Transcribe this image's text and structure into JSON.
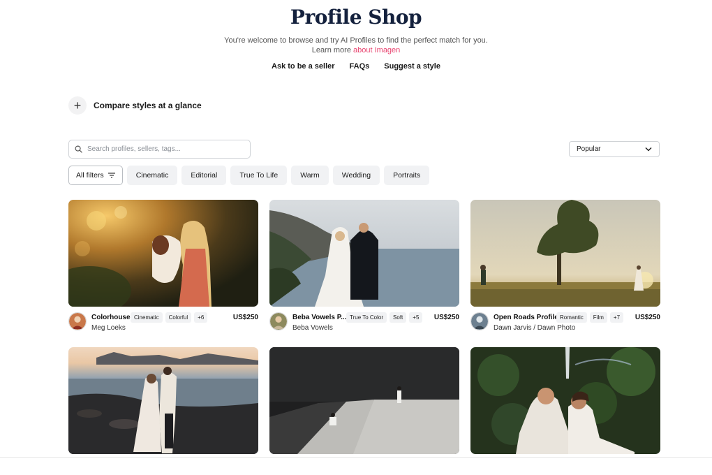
{
  "header": {
    "title": "Profile Shop",
    "subtitle_line1": "You're welcome to browse and try AI Profiles to find the perfect match for you.",
    "subtitle_prefix": "Learn more ",
    "subtitle_link": "about Imagen",
    "nav": [
      "Ask to be a seller",
      "FAQs",
      "Suggest a style"
    ]
  },
  "compare": {
    "label": "Compare styles at a glance",
    "icon": "plus-icon"
  },
  "search": {
    "placeholder": "Search profiles, sellers, tags...",
    "value": ""
  },
  "sort": {
    "selected": "Popular"
  },
  "filters": {
    "all_label": "All filters",
    "chips": [
      "Cinematic",
      "Editorial",
      "True To Life",
      "Warm",
      "Wedding",
      "Portraits"
    ]
  },
  "profiles": [
    {
      "name": "Colorhouse",
      "seller": "Meg Loeks",
      "tags": [
        "Cinematic",
        "Colorful",
        "+6"
      ],
      "price": "US$250"
    },
    {
      "name": "Beba Vowels P...",
      "seller": "Beba Vowels",
      "tags": [
        "True To Color",
        "Soft",
        "+5"
      ],
      "price": "US$250"
    },
    {
      "name": "Open Roads Profile",
      "seller": "Dawn Jarvis / Dawn Photo",
      "tags": [
        "Romantic",
        "Film",
        "+7"
      ],
      "price": "US$250"
    }
  ],
  "colors": {
    "accent_link": "#e8436f",
    "title": "#14213d",
    "chip_bg": "#f1f2f4"
  }
}
